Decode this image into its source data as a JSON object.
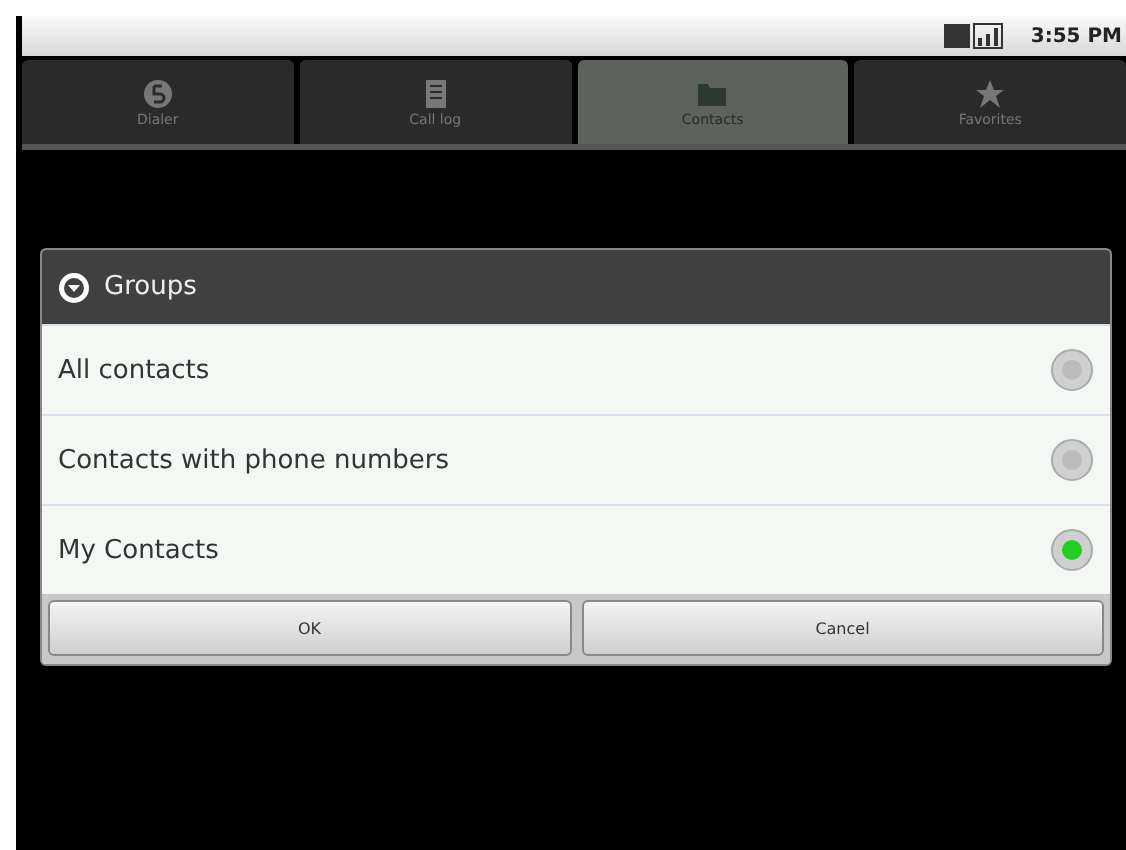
{
  "status_bar": {
    "time": "3:55 PM"
  },
  "tabs": [
    {
      "label": "Dialer",
      "kind": "dialer",
      "selected": false
    },
    {
      "label": "Call log",
      "kind": "calllog",
      "selected": false
    },
    {
      "label": "Contacts",
      "kind": "contacts",
      "selected": true
    },
    {
      "label": "Favorites",
      "kind": "favorites",
      "selected": false
    }
  ],
  "dialog": {
    "title": "Groups",
    "options": [
      {
        "label": "All contacts",
        "selected": false
      },
      {
        "label": "Contacts with phone numbers",
        "selected": false
      },
      {
        "label": "My Contacts",
        "selected": true
      }
    ],
    "buttons": [
      "OK",
      "Cancel"
    ]
  }
}
